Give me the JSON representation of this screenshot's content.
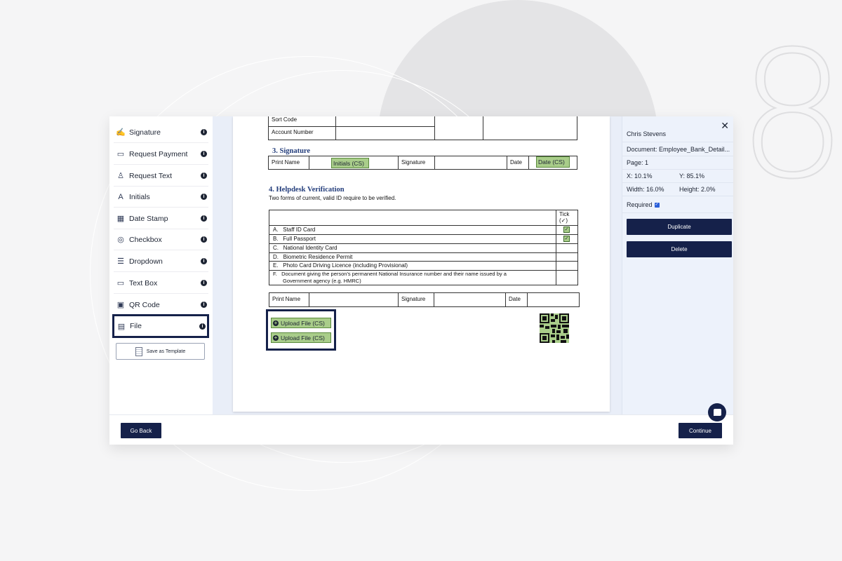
{
  "decor": {
    "big_number": "8"
  },
  "sidebar": {
    "items": [
      {
        "label": "Signature",
        "icon": "signature-icon"
      },
      {
        "label": "Request Payment",
        "icon": "payment-card-icon"
      },
      {
        "label": "Request Text",
        "icon": "request-text-icon"
      },
      {
        "label": "Initials",
        "icon": "initials-icon"
      },
      {
        "label": "Date Stamp",
        "icon": "calendar-icon"
      },
      {
        "label": "Checkbox",
        "icon": "checkbox-icon"
      },
      {
        "label": "Dropdown",
        "icon": "dropdown-icon"
      },
      {
        "label": "Text Box",
        "icon": "text-box-icon"
      },
      {
        "label": "QR Code",
        "icon": "qr-code-icon"
      },
      {
        "label": "File",
        "icon": "file-icon",
        "selected": true
      }
    ],
    "save_template_label": "Save as Template"
  },
  "document": {
    "bank_table": {
      "sort_code_label": "Sort Code",
      "account_number_label": "Account Number"
    },
    "section3": {
      "heading": "3. Signature",
      "print_name_label": "Print Name",
      "initials_field": "Initials (CS)",
      "signature_label": "Signature",
      "date_label": "Date",
      "date_field": "Date (CS)"
    },
    "section4": {
      "heading": "4. Helpdesk Verification",
      "intro": "Two forms of current, valid ID require to be verified.",
      "tick_header": "Tick",
      "tick_symbol": "(✓)",
      "rows": [
        {
          "label": "A.   Staff ID Card",
          "checked": true
        },
        {
          "label": "B.   Full Passport",
          "checked": true
        },
        {
          "label": "C.   National Identity Card",
          "checked": false
        },
        {
          "label": "D.   Biometric Residence Permit",
          "checked": false
        },
        {
          "label": "E.   Photo Card Driving Licence (including Provisional)",
          "checked": false
        },
        {
          "label": "F.   Document giving the person's permanent National Insurance number and their name issued by a",
          "label2": "Government agency (e.g. HMRC)",
          "checked": false
        }
      ],
      "print_name_label": "Print Name",
      "signature_label": "Signature",
      "date_label": "Date"
    },
    "upload_fields": [
      "Upload File (CS)",
      "Upload File (CS)"
    ]
  },
  "properties": {
    "signer": "Chris Stevens",
    "document": "Document: Employee_Bank_Detail...",
    "page": "Page: 1",
    "x": "X: 10.1%",
    "y": "Y: 85.1%",
    "width": "Width: 16.0%",
    "height": "Height: 2.0%",
    "required_label": "Required",
    "required_checked": true,
    "duplicate_label": "Duplicate",
    "delete_label": "Delete"
  },
  "footer": {
    "back_label": "Go Back",
    "continue_label": "Continue"
  },
  "colors": {
    "navy": "#15214a",
    "field_green": "#a9cd8a",
    "heading_blue": "#233d7b"
  }
}
